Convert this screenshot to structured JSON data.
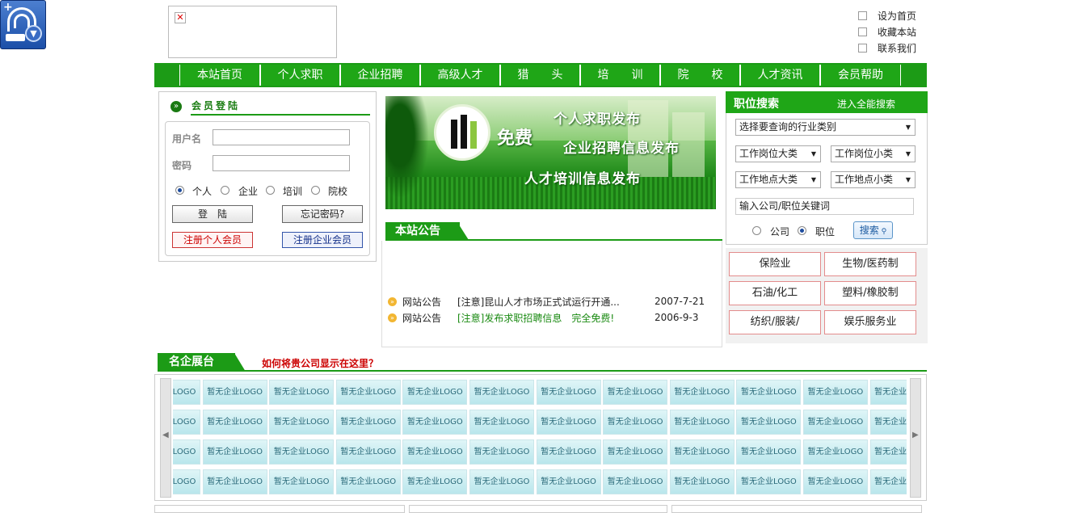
{
  "corner_widget": {
    "icon": "fingerprint-launcher-icon"
  },
  "ad_image": {
    "icon": "broken-image-icon"
  },
  "top_links": [
    {
      "label": "设为首页"
    },
    {
      "label": "收藏本站"
    },
    {
      "label": "联系我们"
    }
  ],
  "nav": {
    "items": [
      "本站首页",
      "个人求职",
      "企业招聘",
      "高级人才",
      "猎　　头",
      "培　　训",
      "院　　校",
      "人才资讯",
      "会员帮助"
    ]
  },
  "login": {
    "title": "会员登陆",
    "username_label": "用户名",
    "password_label": "密码",
    "user_types": [
      "个人",
      "企业",
      "培训",
      "院校"
    ],
    "selected_type": "个人",
    "login_button": "登　陆",
    "forgot_button": "忘记密码?",
    "register_person": "注册个人会员",
    "register_company": "注册企业会员"
  },
  "banner": {
    "free": "免费",
    "line1": "个人求职发布",
    "line2": "企业招聘信息发布",
    "line3": "人才培训信息发布"
  },
  "notice": {
    "title": "本站公告",
    "items": [
      {
        "category": "网站公告",
        "text": "[注意]昆山人才市场正式试运行开通...",
        "date": "2007-7-21",
        "highlight": false
      },
      {
        "category": "网站公告",
        "text": "[注意]发布求职招聘信息　完全免费!",
        "date": "2006-9-3",
        "highlight": true
      }
    ]
  },
  "job_search": {
    "title": "职位搜索",
    "advanced_link": "进入全能搜索",
    "industry_select": "选择要查询的行业类别",
    "job_major": "工作岗位大类",
    "job_minor": "工作岗位小类",
    "loc_major": "工作地点大类",
    "loc_minor": "工作地点小类",
    "keyword_placeholder": "输入公司/职位关键词",
    "scope_options": [
      "公司",
      "职位"
    ],
    "selected_scope": "职位",
    "search_button": "搜索"
  },
  "industries": [
    "保险业",
    "生物/医药制",
    "石油/化工",
    "塑料/橡胶制",
    "纺织/服装/",
    "娱乐服务业"
  ],
  "featured": {
    "title": "名企展台",
    "hint": "如何将贵公司显示在这里？",
    "logo_placeholder": "暂无企业LOGO"
  },
  "colors": {
    "brand_green": "#1c9b16",
    "notice_green": "#1a8a12",
    "alert_red": "#cc0000"
  }
}
